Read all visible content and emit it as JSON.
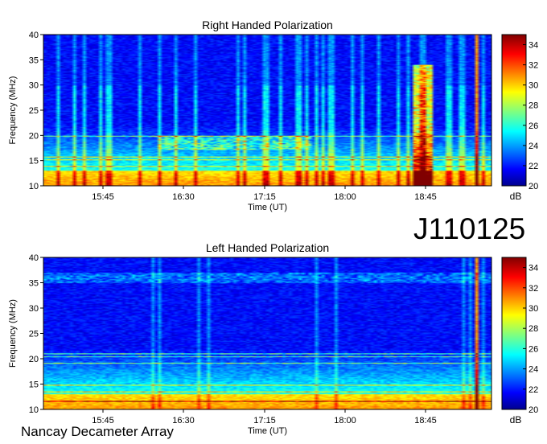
{
  "observation_id": "J110125",
  "instrument": "Nancay Decameter Array",
  "chart_data": [
    {
      "type": "heatmap",
      "title": "Right Handed Polarization",
      "xlabel": "Time (UT)",
      "ylabel": "Frequency (MHz)",
      "x_ticks": [
        "15:45",
        "16:30",
        "17:15",
        "18:00",
        "18:45"
      ],
      "y_ticks": [
        10,
        15,
        20,
        25,
        30,
        35,
        40
      ],
      "ylim": [
        10,
        40
      ],
      "colorbar": {
        "label": "dB",
        "ticks": [
          20,
          22,
          24,
          26,
          28,
          30,
          32,
          34
        ],
        "range": [
          20,
          35
        ]
      },
      "grid": false
    },
    {
      "type": "heatmap",
      "title": "Left Handed Polarization",
      "xlabel": "Time (UT)",
      "ylabel": "Frequency (MHz)",
      "x_ticks": [
        "15:45",
        "16:30",
        "17:15",
        "18:00",
        "18:45"
      ],
      "y_ticks": [
        10,
        15,
        20,
        25,
        30,
        35,
        40
      ],
      "ylim": [
        10,
        40
      ],
      "colorbar": {
        "label": "dB",
        "ticks": [
          20,
          22,
          24,
          26,
          28,
          30,
          32,
          34
        ],
        "range": [
          20,
          35
        ]
      },
      "grid": false
    }
  ]
}
